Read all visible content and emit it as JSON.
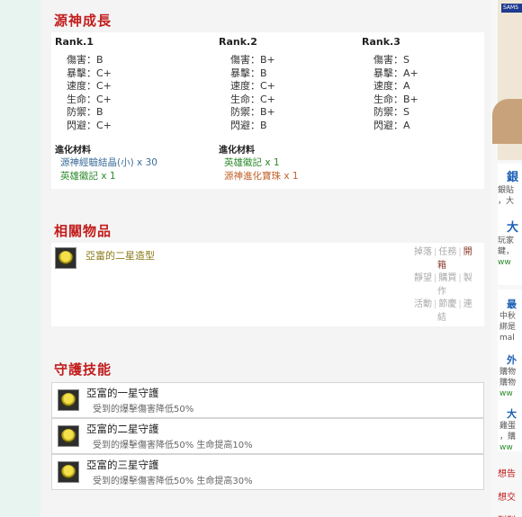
{
  "growth": {
    "title": "源神成長",
    "ranks": [
      {
        "label": "Rank.1",
        "stats": [
          {
            "name": "傷害",
            "value": "B"
          },
          {
            "name": "暴擊",
            "value": "C+"
          },
          {
            "name": "速度",
            "value": "C+"
          },
          {
            "name": "生命",
            "value": "C+"
          },
          {
            "name": "防禦",
            "value": "B"
          },
          {
            "name": "閃避",
            "value": "C+"
          }
        ]
      },
      {
        "label": "Rank.2",
        "stats": [
          {
            "name": "傷害",
            "value": "B+"
          },
          {
            "name": "暴擊",
            "value": "B"
          },
          {
            "name": "速度",
            "value": "C+"
          },
          {
            "name": "生命",
            "value": "C+"
          },
          {
            "name": "防禦",
            "value": "B+"
          },
          {
            "name": "閃避",
            "value": "B"
          }
        ]
      },
      {
        "label": "Rank.3",
        "stats": [
          {
            "name": "傷害",
            "value": "S"
          },
          {
            "name": "暴擊",
            "value": "A+"
          },
          {
            "name": "速度",
            "value": "A"
          },
          {
            "name": "生命",
            "value": "B+"
          },
          {
            "name": "防禦",
            "value": "S"
          },
          {
            "name": "閃避",
            "value": "A"
          }
        ]
      }
    ],
    "evo_title_1": "進化材料",
    "evo_title_2": "進化材料",
    "evo1": [
      {
        "name": "源神經驗結晶(小)",
        "qty": "x 30",
        "color": "#3a6d99"
      },
      {
        "name": "英雄徽記",
        "qty": "x 1",
        "color": "#2a8a2a"
      }
    ],
    "evo2": [
      {
        "name": "英雄徽記",
        "qty": "x 1",
        "color": "#2a8a2a"
      },
      {
        "name": "源神進化寶珠",
        "qty": "x 1",
        "color": "#c0612a"
      }
    ]
  },
  "related": {
    "title": "相關物品",
    "item_name": "亞富的二星造型",
    "tags": {
      "row1": [
        "掉落",
        "任務",
        "開",
        "箱"
      ],
      "row2": [
        "靜望",
        "購買",
        "製",
        "作"
      ],
      "row3": [
        "活動",
        "節慶",
        "連",
        "結"
      ]
    }
  },
  "guard": {
    "title": "守護技能",
    "skills": [
      {
        "name": "亞富的一星守護",
        "desc": "受到的爆擊傷害降低50%"
      },
      {
        "name": "亞富的二星守護",
        "desc": "受到的爆擊傷害降低50% 生命提高10%"
      },
      {
        "name": "亞富的三星守護",
        "desc": "受到的爆擊傷害降低50% 生命提高30%"
      }
    ]
  },
  "right": {
    "ad_brand": "SAMS",
    "link1": "銀",
    "text1": "銀貼",
    "text1b": "，大",
    "link2": "大",
    "text2": "玩家",
    "text2b": "鍵，",
    "text2c": "ww",
    "link3": "最",
    "text3": "中秋",
    "text3b": "綁是",
    "text3c": "mal",
    "link4": "外",
    "text4": "購物",
    "text4b": "購物",
    "text4c": "ww",
    "link5": "大",
    "text5": "雞蛋",
    "text5b": "，購",
    "text5c": "ww",
    "foot1": "想告",
    "foot2": "想交",
    "foot3": "刊刊"
  }
}
